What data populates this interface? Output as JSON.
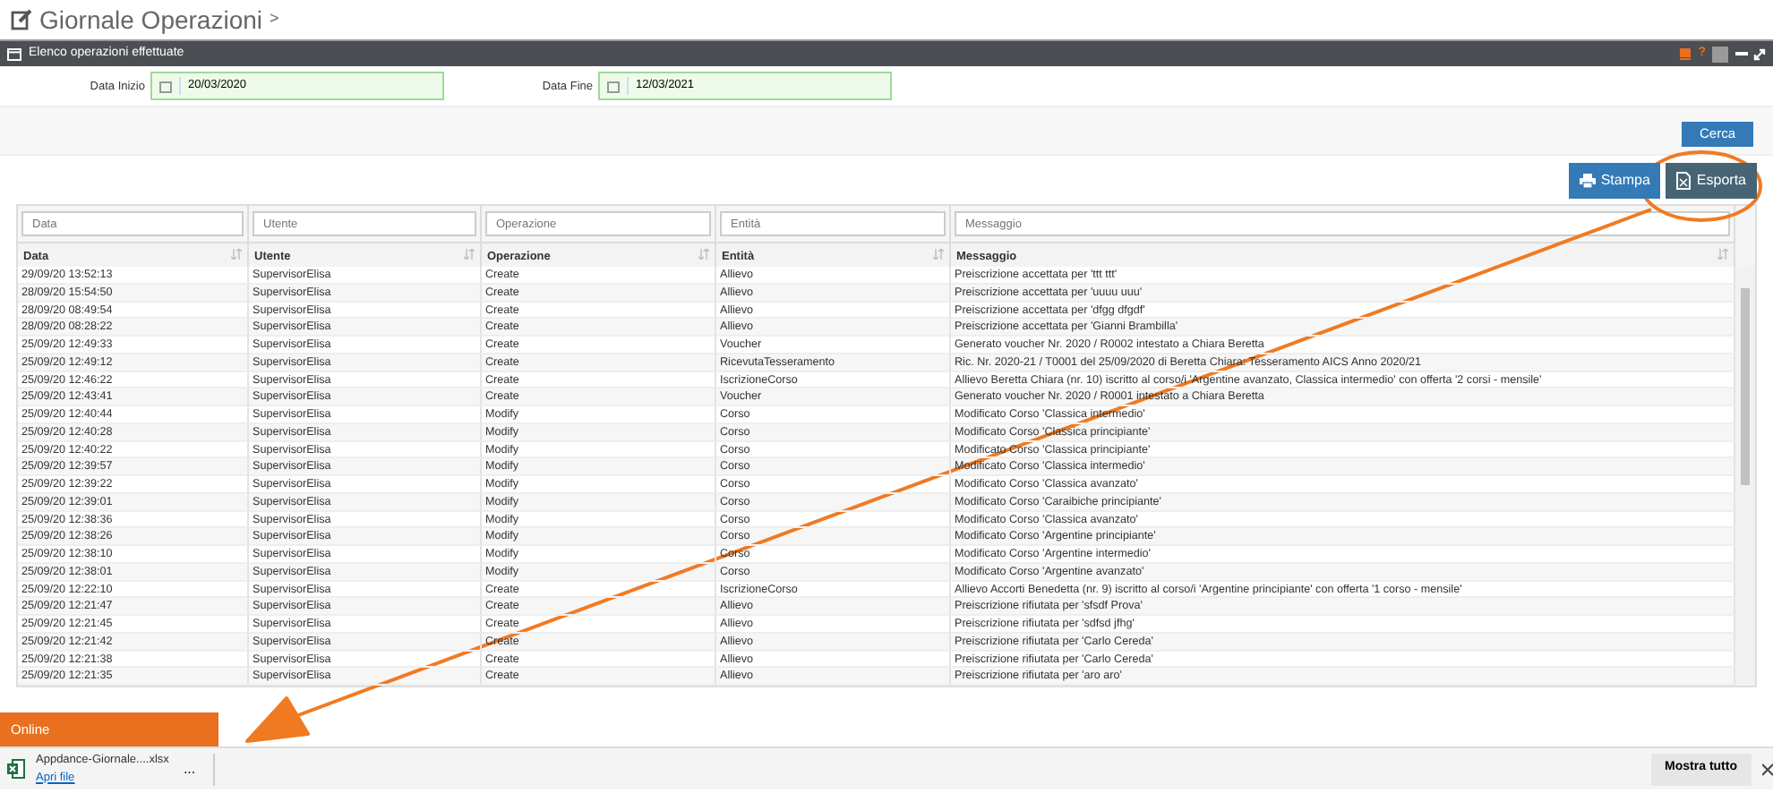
{
  "page": {
    "title": "Giornale Operazioni",
    "breadcrumb_mark": ">"
  },
  "panel": {
    "title": "Elenco operazioni effettuate",
    "toolbar_help": "?"
  },
  "filters": {
    "start": {
      "label": "Data Inizio",
      "value": "20/03/2020"
    },
    "end": {
      "label": "Data Fine",
      "value": "12/03/2021"
    }
  },
  "search_button": "Cerca",
  "actions": [
    {
      "label": "Stampa",
      "kind": "print"
    },
    {
      "label": "Esporta",
      "kind": "export"
    }
  ],
  "table": {
    "columns": [
      {
        "label": "Data",
        "placeholder": "Data"
      },
      {
        "label": "Utente",
        "placeholder": "Utente"
      },
      {
        "label": "Operazione",
        "placeholder": "Operazione"
      },
      {
        "label": "Entità",
        "placeholder": "Entità"
      },
      {
        "label": "Messaggio",
        "placeholder": "Messaggio"
      }
    ],
    "rows": [
      [
        "29/09/20 13:52:13",
        "SupervisorElisa",
        "Create",
        "Allievo",
        "Preiscrizione accettata per 'ttt ttt'"
      ],
      [
        "28/09/20 15:54:50",
        "SupervisorElisa",
        "Create",
        "Allievo",
        "Preiscrizione accettata per 'uuuu uuu'"
      ],
      [
        "28/09/20 08:49:54",
        "SupervisorElisa",
        "Create",
        "Allievo",
        "Preiscrizione accettata per 'dfgg dfgdf'"
      ],
      [
        "28/09/20 08:28:22",
        "SupervisorElisa",
        "Create",
        "Allievo",
        "Preiscrizione accettata per 'Gianni Brambilla'"
      ],
      [
        "25/09/20 12:49:33",
        "SupervisorElisa",
        "Create",
        "Voucher",
        "Generato voucher Nr. 2020 / R0002 intestato a Chiara Beretta"
      ],
      [
        "25/09/20 12:49:12",
        "SupervisorElisa",
        "Create",
        "RicevutaTesseramento",
        "Ric. Nr. 2020-21 / T0001 del 25/09/2020 di Beretta Chiara: Tesseramento AICS Anno 2020/21"
      ],
      [
        "25/09/20 12:46:22",
        "SupervisorElisa",
        "Create",
        "IscrizioneCorso",
        "Allievo Beretta Chiara (nr. 10) iscritto al corso/i 'Argentine avanzato, Classica intermedio' con offerta '2 corsi - mensile'"
      ],
      [
        "25/09/20 12:43:41",
        "SupervisorElisa",
        "Create",
        "Voucher",
        "Generato voucher Nr. 2020 / R0001 intestato a Chiara Beretta"
      ],
      [
        "25/09/20 12:40:44",
        "SupervisorElisa",
        "Modify",
        "Corso",
        "Modificato Corso 'Classica intermedio'"
      ],
      [
        "25/09/20 12:40:28",
        "SupervisorElisa",
        "Modify",
        "Corso",
        "Modificato Corso 'Classica principiante'"
      ],
      [
        "25/09/20 12:40:22",
        "SupervisorElisa",
        "Modify",
        "Corso",
        "Modificato Corso 'Classica principiante'"
      ],
      [
        "25/09/20 12:39:57",
        "SupervisorElisa",
        "Modify",
        "Corso",
        "Modificato Corso 'Classica intermedio'"
      ],
      [
        "25/09/20 12:39:22",
        "SupervisorElisa",
        "Modify",
        "Corso",
        "Modificato Corso 'Classica avanzato'"
      ],
      [
        "25/09/20 12:39:01",
        "SupervisorElisa",
        "Modify",
        "Corso",
        "Modificato Corso 'Caraibiche principiante'"
      ],
      [
        "25/09/20 12:38:36",
        "SupervisorElisa",
        "Modify",
        "Corso",
        "Modificato Corso 'Classica avanzato'"
      ],
      [
        "25/09/20 12:38:26",
        "SupervisorElisa",
        "Modify",
        "Corso",
        "Modificato Corso 'Argentine principiante'"
      ],
      [
        "25/09/20 12:38:10",
        "SupervisorElisa",
        "Modify",
        "Corso",
        "Modificato Corso 'Argentine intermedio'"
      ],
      [
        "25/09/20 12:38:01",
        "SupervisorElisa",
        "Modify",
        "Corso",
        "Modificato Corso 'Argentine avanzato'"
      ],
      [
        "25/09/20 12:22:10",
        "SupervisorElisa",
        "Create",
        "IscrizioneCorso",
        "Allievo Accorti Benedetta (nr. 9) iscritto al corso/i 'Argentine principiante' con offerta '1 corso - mensile'"
      ],
      [
        "25/09/20 12:21:47",
        "SupervisorElisa",
        "Create",
        "Allievo",
        "Preiscrizione rifiutata per 'sfsdf Prova'"
      ],
      [
        "25/09/20 12:21:45",
        "SupervisorElisa",
        "Create",
        "Allievo",
        "Preiscrizione rifiutata per 'sdfsd jfhg'"
      ],
      [
        "25/09/20 12:21:42",
        "SupervisorElisa",
        "Create",
        "Allievo",
        "Preiscrizione rifiutata per 'Carlo Cereda'"
      ],
      [
        "25/09/20 12:21:38",
        "SupervisorElisa",
        "Create",
        "Allievo",
        "Preiscrizione rifiutata per 'Carlo Cereda'"
      ],
      [
        "25/09/20 12:21:35",
        "SupervisorElisa",
        "Create",
        "Allievo",
        "Preiscrizione rifiutata per 'aro aro'"
      ]
    ]
  },
  "status_tab": "Online",
  "download_bar": {
    "file_name": "Appdance-Giornale....xlsx",
    "open_link": "Apri file",
    "more": "...",
    "show_all": "Mostra tutto"
  }
}
